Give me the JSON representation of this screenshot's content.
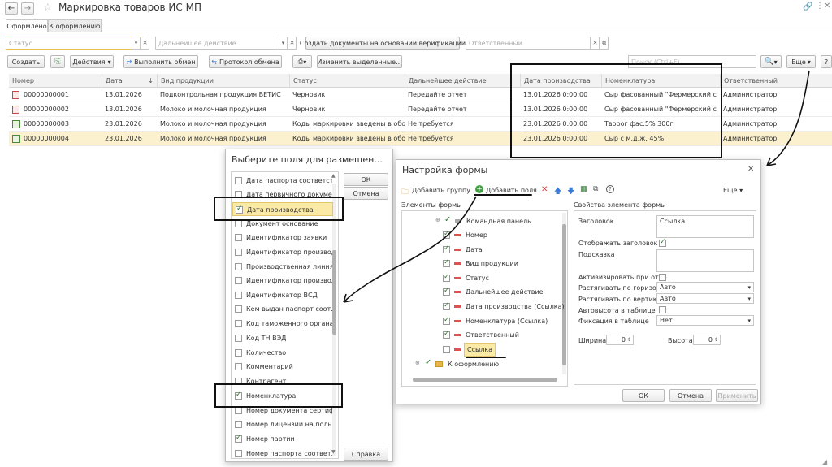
{
  "app": {
    "title": "Маркировка товаров ИС МП",
    "back_icon": "arrow-left-icon",
    "forward_icon": "arrow-right-icon",
    "star_icon": "star-icon"
  },
  "tabs": [
    {
      "label": "Оформлено",
      "active": true
    },
    {
      "label": "К оформлению",
      "active": false
    }
  ],
  "filters": {
    "status_placeholder": "Статус",
    "next_action_placeholder": "Дальнейшее действие",
    "create_docs_label": "Создать документы на основании верификаций",
    "responsible_placeholder": "Ответственный"
  },
  "toolbar": {
    "create_label": "Создать",
    "actions_label": "Действия",
    "run_exchange_label": "Выполнить обмен",
    "protocol_label": "Протокол обмена",
    "change_selected_label": "Изменить выделенные...",
    "search_placeholder": "Поиск (Ctrl+F)",
    "more_label": "Еще",
    "help_label": "?"
  },
  "table": {
    "columns": [
      "Номер",
      "Дата",
      "Вид продукции",
      "Статус",
      "Дальнейшее действие",
      "Дата производства",
      "Номенклатура",
      "Ответственный"
    ],
    "sort_indicator": "↓",
    "rows": [
      {
        "num": "00000000001",
        "date": "13.01.2026",
        "kind": "Подконтрольная продукция ВЕТИС",
        "status": "Черновик",
        "next": "Передайте отчет",
        "prod_date": "13.01.2026 0:00:00",
        "nomen": "Сыр фасованный \"Фермерский с",
        "resp": "Администратор",
        "icon": "draft-doc-icon",
        "selected": false
      },
      {
        "num": "00000000002",
        "date": "13.01.2026",
        "kind": "Молоко и молочная продукция",
        "status": "Черновик",
        "next": "Передайте отчет",
        "prod_date": "13.01.2026 0:00:00",
        "nomen": "Сыр фасованный \"Фермерский с",
        "resp": "Администратор",
        "icon": "draft-doc-icon",
        "selected": false
      },
      {
        "num": "00000000003",
        "date": "23.01.2026",
        "kind": "Молоко и молочная продукция",
        "status": "Коды маркировки введены в оборот",
        "next": "Не требуется",
        "prod_date": "23.01.2026 0:00:00",
        "nomen": "Творог фас.5%  300г",
        "resp": "Администратор",
        "icon": "posted-doc-icon",
        "selected": false
      },
      {
        "num": "00000000004",
        "date": "23.01.2026",
        "kind": "Молоко и молочная продукция",
        "status": "Коды маркировки введены в оборот",
        "next": "Не требуется",
        "prod_date": "23.01.2026 0:00:00",
        "nomen": "Сыр           с м.д.ж. 45%",
        "resp": "Администратор",
        "icon": "posted-doc-icon",
        "selected": true
      }
    ]
  },
  "field_picker": {
    "title": "Выберите поля для размещен...",
    "ok_label": "ОК",
    "cancel_label": "Отмена",
    "help_label": "Справка",
    "items": [
      {
        "label": "Дата паспорта соответст...",
        "checked": false
      },
      {
        "label": "Дата первичного докуме...",
        "checked": false
      },
      {
        "label": "Дата производства",
        "checked": true
      },
      {
        "label": "Документ основание",
        "checked": false
      },
      {
        "label": "Идентификатор заявки",
        "checked": false
      },
      {
        "label": "Идентификатор производ...",
        "checked": false
      },
      {
        "label": "Производственная линия",
        "checked": false
      },
      {
        "label": "Идентификатор производ...",
        "checked": false
      },
      {
        "label": "Идентификатор ВСД",
        "checked": false
      },
      {
        "label": "Кем выдан паспорт соот...",
        "checked": false
      },
      {
        "label": "Код таможенного органа",
        "checked": false
      },
      {
        "label": "Код ТН ВЭД",
        "checked": false
      },
      {
        "label": "Количество",
        "checked": false
      },
      {
        "label": "Комментарий",
        "checked": false
      },
      {
        "label": "Контрагент",
        "checked": false
      },
      {
        "label": "Номенклатура",
        "checked": true
      },
      {
        "label": "Номер документа сертиф...",
        "checked": false
      },
      {
        "label": "Номер лицензии на поль...",
        "checked": false
      },
      {
        "label": "Номер партии",
        "checked": true
      },
      {
        "label": "Номер паспорта соответ...",
        "checked": false
      }
    ]
  },
  "form_settings": {
    "title": "Настройка формы",
    "add_group_label": "Добавить группу",
    "add_fields_label": "Добавить поля",
    "more_label": "Еще",
    "elements_header": "Элементы формы",
    "props_header": "Свойства элемента формы",
    "tree": [
      {
        "label": "Командная панель",
        "checked": true,
        "kind": "panel"
      },
      {
        "label": "Номер",
        "checked": true,
        "kind": "field"
      },
      {
        "label": "Дата",
        "checked": true,
        "kind": "field"
      },
      {
        "label": "Вид продукции",
        "checked": true,
        "kind": "field"
      },
      {
        "label": "Статус",
        "checked": true,
        "kind": "field"
      },
      {
        "label": "Дальнейшее действие",
        "checked": true,
        "kind": "field"
      },
      {
        "label": "Дата производства (Ссылка)",
        "checked": true,
        "kind": "field"
      },
      {
        "label": "Номенклатура (Ссылка)",
        "checked": true,
        "kind": "field"
      },
      {
        "label": "Ответственный",
        "checked": true,
        "kind": "field"
      },
      {
        "label": "Ссылка",
        "checked": false,
        "kind": "field"
      },
      {
        "label": "К оформлению",
        "checked": true,
        "kind": "group"
      }
    ],
    "props": {
      "caption_label": "Заголовок",
      "caption_value": "Ссылка",
      "show_caption_label": "Отображать заголовок",
      "hint_label": "Подсказка",
      "activate_label": "Активизировать при откр",
      "stretch_h_label": "Растягивать по горизонта",
      "stretch_h_value": "Авто",
      "stretch_v_label": "Растягивать по вертикали",
      "stretch_v_value": "Авто",
      "autoheight_label": "Автовысота в таблице",
      "fix_label": "Фиксация в таблице",
      "fix_value": "Нет",
      "width_label": "Ширина",
      "width_value": "0",
      "height_label": "Высота",
      "height_value": "0"
    },
    "ok_label": "ОК",
    "cancel_label": "Отмена",
    "apply_label": "Применить"
  }
}
